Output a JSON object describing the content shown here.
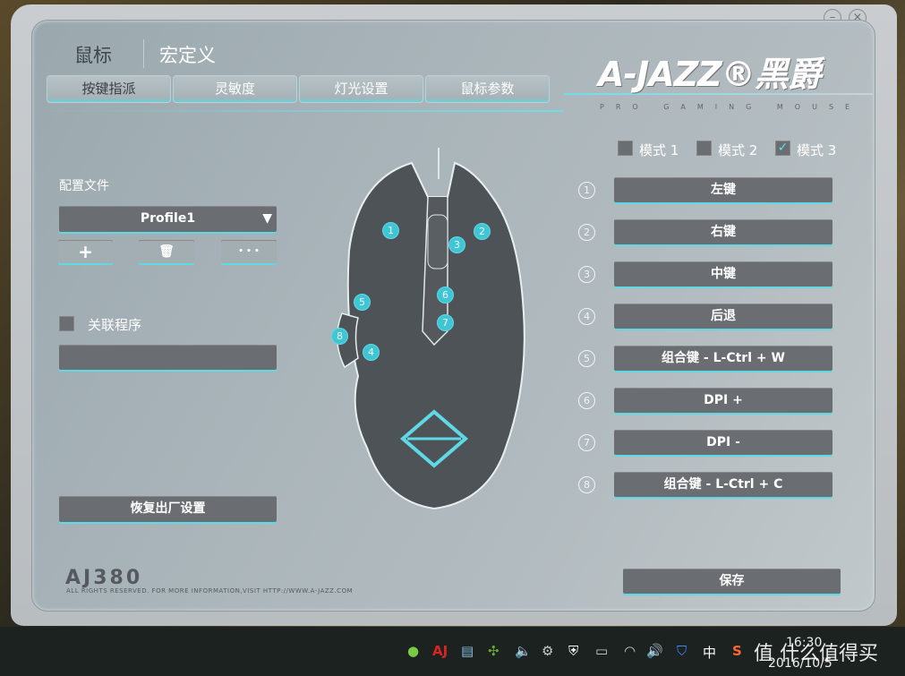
{
  "window": {
    "minimize": "–",
    "close": "×"
  },
  "header": {
    "mouse": "鼠标",
    "macro": "宏定义"
  },
  "tabs": [
    "按键指派",
    "灵敏度",
    "灯光设置",
    "鼠标参数"
  ],
  "brand": {
    "logo": "A-JAZZ®黑爵",
    "tagline": "PRO GAMING MOUSE"
  },
  "modes": [
    {
      "label": "模式 1",
      "checked": false
    },
    {
      "label": "模式 2",
      "checked": false
    },
    {
      "label": "模式 3",
      "checked": true
    }
  ],
  "profile": {
    "label": "配置文件",
    "selected": "Profile1",
    "add": "+",
    "delete_icon": "trash-icon",
    "more": "• • •"
  },
  "link_program": {
    "label": "关联程序",
    "checked": false,
    "value": ""
  },
  "restore": "恢复出厂设置",
  "buttons": [
    {
      "num": "1",
      "label": "左键"
    },
    {
      "num": "2",
      "label": "右键"
    },
    {
      "num": "3",
      "label": "中键"
    },
    {
      "num": "4",
      "label": "后退"
    },
    {
      "num": "5",
      "label": "组合键 - L-Ctrl + W"
    },
    {
      "num": "6",
      "label": "DPI +"
    },
    {
      "num": "7",
      "label": "DPI -"
    },
    {
      "num": "8",
      "label": "组合键 - L-Ctrl + C"
    }
  ],
  "save": "保存",
  "footer": {
    "model": "AJ380",
    "rights": "ALL RIGHTS RESERVED. FOR MORE INFORMATION,VISIT HTTP://WWW.A-JAZZ.COM"
  },
  "taskbar": {
    "ime": "中",
    "time": "16:30",
    "date": "2016/10/5",
    "watermark": "值 什么值得买"
  },
  "colors": {
    "accent": "#5fd9e6",
    "button": "#6a6d71"
  }
}
